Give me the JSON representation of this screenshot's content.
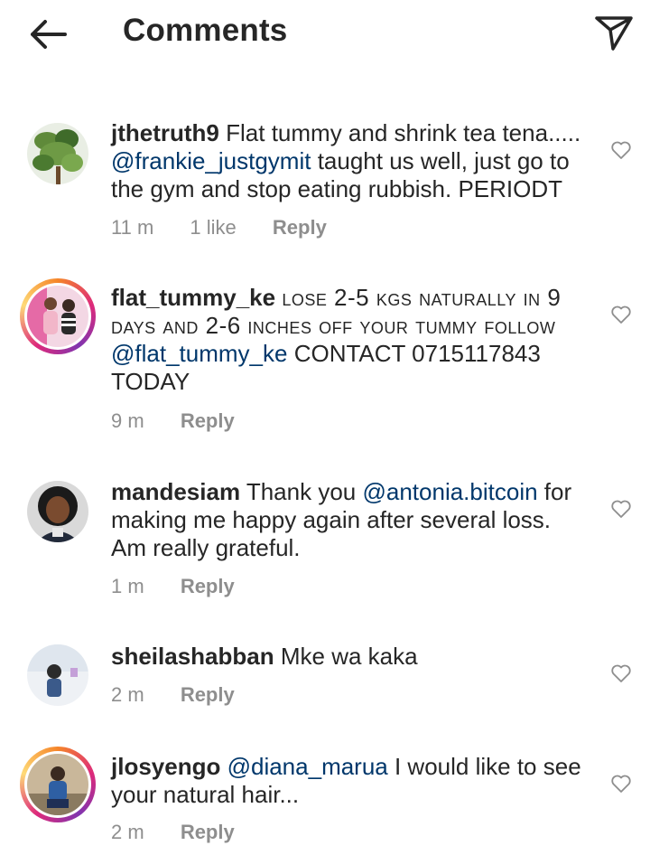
{
  "header": {
    "title": "Comments",
    "back_icon": "arrow-left-icon",
    "share_icon": "paper-plane-icon"
  },
  "comments": [
    {
      "username": "jthetruth9",
      "text_parts": [
        "Flat tummy and shrink tea tena..... ",
        "@frankie_justgymit",
        " taught us well, just go to the gym and stop eating rubbish. PERIODT"
      ],
      "time": "11 m",
      "likes": "1 like",
      "reply": "Reply"
    },
    {
      "username": "flat_tummy_ke",
      "text_parts": [
        "lose 2-5 kgs naturally in 9 days and 2-6 inches off your tummy follow ",
        "@flat_tummy_ke",
        " CONTACT 0715117843 TODAY"
      ],
      "time": "9 m",
      "reply": "Reply"
    },
    {
      "username": "mandesiam",
      "text_parts": [
        "Thank you ",
        "@antonia.bitcoin",
        " for making me happy again after several loss. Am really grateful."
      ],
      "time": "1 m",
      "reply": "Reply"
    },
    {
      "username": "sheilashabban",
      "text_parts": [
        "Mke wa kaka"
      ],
      "time": "2 m",
      "reply": "Reply"
    },
    {
      "username": "jlosyengo",
      "text_parts": [
        "@diana_marua",
        " I would like to see your natural hair..."
      ],
      "time": "2 m",
      "reply": "Reply"
    }
  ],
  "colors": {
    "text": "#262626",
    "muted": "#8e8e8e",
    "mention": "#00376b",
    "story_ring_start": "#f58529",
    "story_ring_end": "#dd2a7b"
  }
}
